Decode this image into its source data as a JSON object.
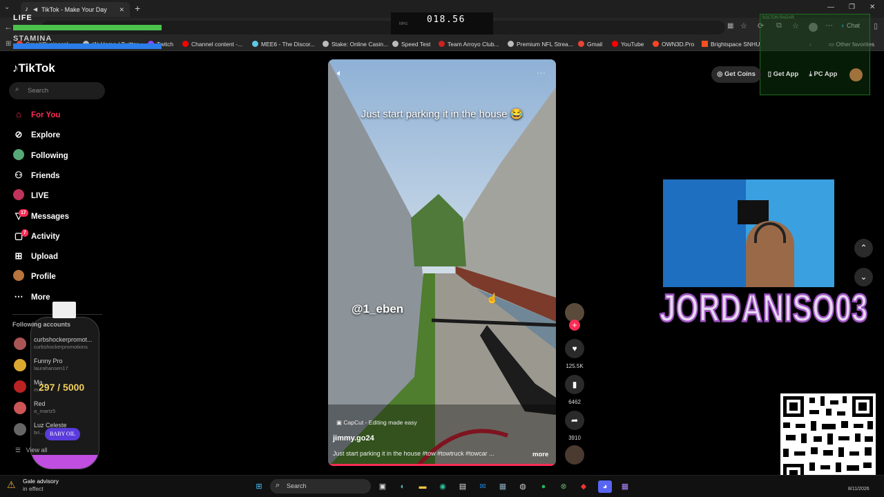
{
  "hud": {
    "life": "LIFE",
    "stamina": "STAMINA",
    "mhz_label": "MHz",
    "frequency": "018.56"
  },
  "browser": {
    "tab_title": "TikTok - Make Your Day",
    "new_tab": "+",
    "chat_label": "Chat",
    "other_favorites": "Other favorites",
    "bookmarks": [
      {
        "label": "Gmail(Business)",
        "color": "#ea4335"
      },
      {
        "label": "(1) Home / Twitter",
        "color": "#bbbbbb"
      },
      {
        "label": "Twitch",
        "color": "#9146ff"
      },
      {
        "label": "Channel content -...",
        "color": "#ff0000"
      },
      {
        "label": "MEE6 - The Discor...",
        "color": "#5ec8e5"
      },
      {
        "label": "Stake: Online Casin...",
        "color": "#bbbbbb"
      },
      {
        "label": "Speed Test",
        "color": "#bbbbbb"
      },
      {
        "label": "Team Arroyo Club...",
        "color": "#cc2222"
      },
      {
        "label": "Premium NFL Strea...",
        "color": "#bbbbbb"
      },
      {
        "label": "Gmail",
        "color": "#ea4335"
      },
      {
        "label": "YouTube",
        "color": "#ff0000"
      },
      {
        "label": "OWN3D.Pro",
        "color": "#ff4422"
      },
      {
        "label": "Brightspace SNHU",
        "color": "#f25022"
      }
    ]
  },
  "tiktok": {
    "logo": "TikTok",
    "search_placeholder": "Search",
    "nav": [
      {
        "label": "For You",
        "icon": "home-icon",
        "active": true
      },
      {
        "label": "Explore",
        "icon": "compass-icon"
      },
      {
        "label": "Following",
        "icon": "following-avatar-icon"
      },
      {
        "label": "Friends",
        "icon": "friends-icon"
      },
      {
        "label": "LIVE",
        "icon": "live-icon"
      },
      {
        "label": "Messages",
        "icon": "messages-icon",
        "badge": "17"
      },
      {
        "label": "Activity",
        "icon": "activity-icon",
        "badge": "7"
      },
      {
        "label": "Upload",
        "icon": "upload-icon"
      },
      {
        "label": "Profile",
        "icon": "profile-icon"
      },
      {
        "label": "More",
        "icon": "more-dots-icon"
      }
    ],
    "following_title": "Following accounts",
    "accounts": [
      {
        "name": "curbshockerpromot...",
        "handle": "curbshockerpromotions"
      },
      {
        "name": "Funny Pro",
        "handle": "laurahansen17"
      },
      {
        "name": "Ma...",
        "handle": "m..."
      },
      {
        "name": "Red",
        "handle": "a_martz5"
      },
      {
        "name": "Luz Celeste",
        "handle": "bri..."
      }
    ],
    "view_all": "View all",
    "header_buttons": {
      "get_coins": "Get Coins",
      "get_app": "Get App",
      "pc_app": "PC App"
    },
    "video": {
      "caption_overlay": "Just start parking it in the house 😂",
      "tag_overlay": "@1_eben",
      "capcut": "CapCut - Editing made easy",
      "author": "jimmy.go24",
      "description": "Just start parking it in the house #tow #towtruck #towcar ...",
      "more": "more"
    },
    "actions": {
      "likes": "125.5K",
      "saves": "6462",
      "shares": "3910"
    }
  },
  "overlay": {
    "streamer_name": "JORDANISO03",
    "counter": "297 / 5000",
    "bottle_label": "BABY OIL",
    "radar_label": "SOLTON RADAR"
  },
  "taskbar": {
    "weather_title": "Gale advisory",
    "weather_sub": "in effect",
    "search": "Search",
    "date": "8/11/2026"
  },
  "colors": {
    "tiktok_red": "#fe2c55",
    "hud_green": "#4cc24c",
    "hud_blue": "#2b7de9"
  }
}
